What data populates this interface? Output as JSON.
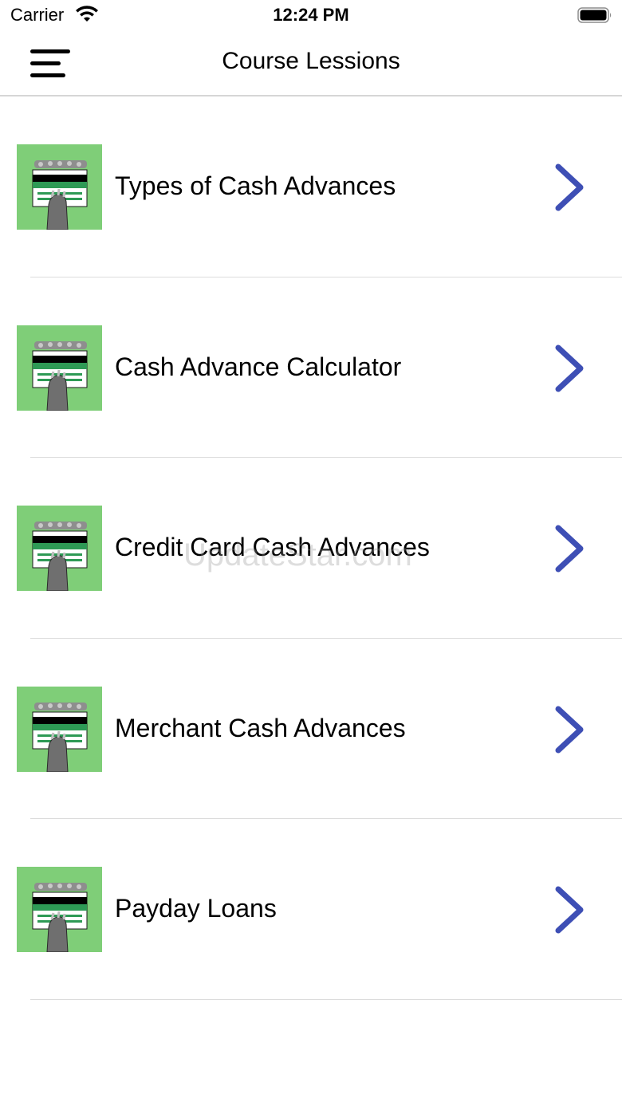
{
  "status_bar": {
    "carrier": "Carrier",
    "time": "12:24 PM",
    "wifi_icon": "wifi-icon",
    "battery_icon": "battery-icon"
  },
  "nav": {
    "title": "Course Lessions",
    "menu_icon": "hamburger-menu-icon"
  },
  "lessons": [
    {
      "label": "Types of Cash Advances",
      "thumb_icon": "cash-card-thumbnail",
      "chevron_icon": "chevron-right-icon"
    },
    {
      "label": "Cash Advance Calculator",
      "thumb_icon": "cash-card-thumbnail",
      "chevron_icon": "chevron-right-icon"
    },
    {
      "label": "Credit Card Cash Advances",
      "thumb_icon": "cash-card-thumbnail",
      "chevron_icon": "chevron-right-icon"
    },
    {
      "label": "Merchant Cash Advances",
      "thumb_icon": "cash-card-thumbnail",
      "chevron_icon": "chevron-right-icon"
    },
    {
      "label": "Payday Loans",
      "thumb_icon": "cash-card-thumbnail",
      "chevron_icon": "chevron-right-icon"
    }
  ],
  "watermark": "UpdateStar.com",
  "colors": {
    "thumb_bg": "#7fce78",
    "chevron": "#3e4fb5",
    "divider": "#dcdcdc"
  }
}
